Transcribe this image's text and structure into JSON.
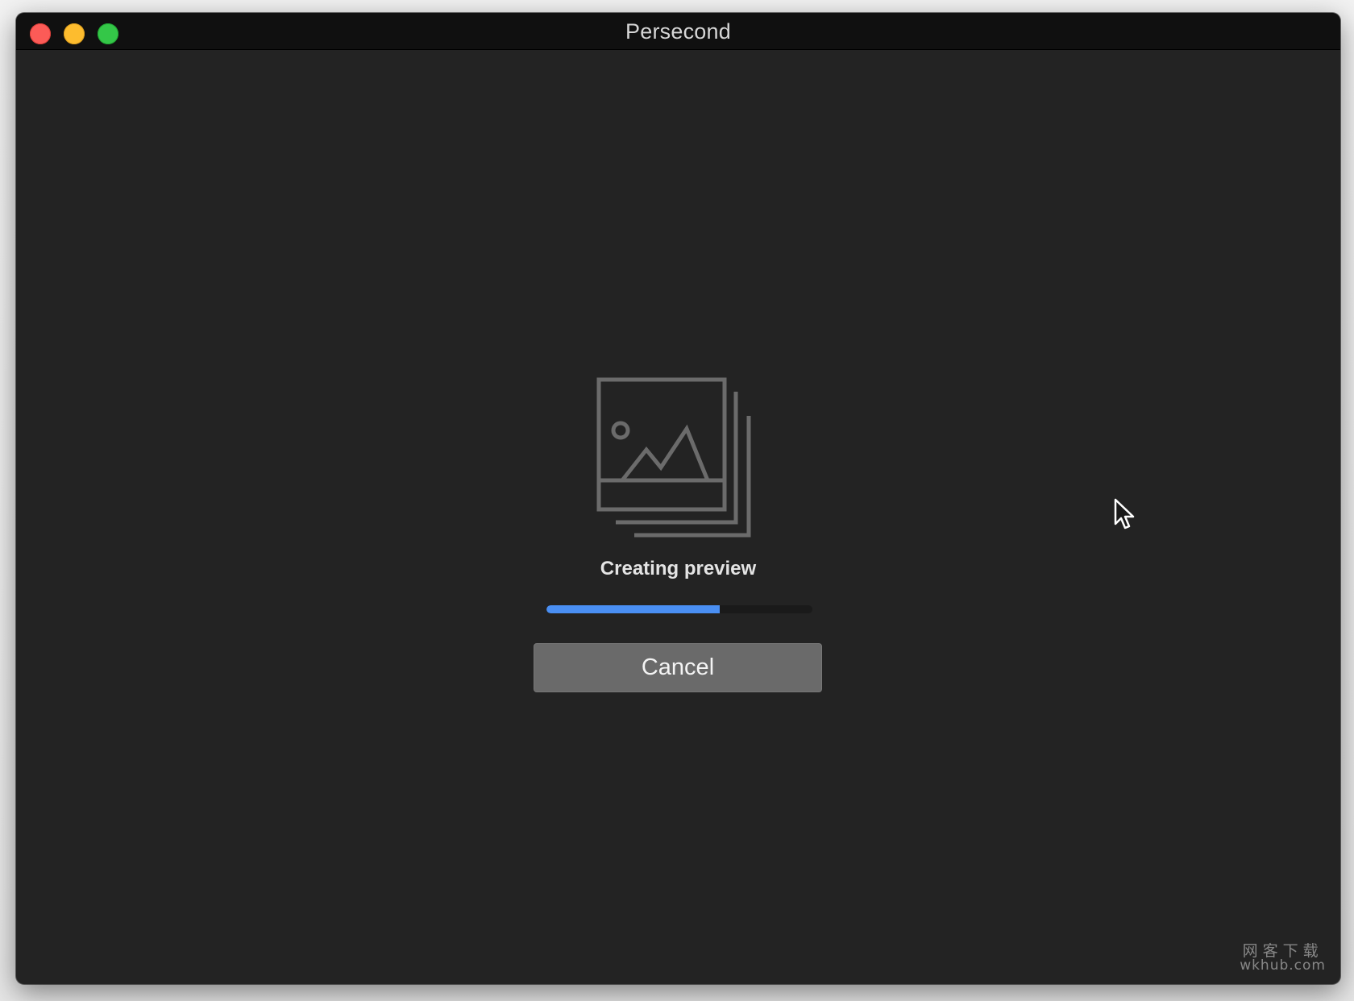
{
  "window": {
    "title": "Persecond"
  },
  "titlebar": {
    "buttons": [
      {
        "name": "close",
        "color": "#fc5b57"
      },
      {
        "name": "minimize",
        "color": "#fdbc2e"
      },
      {
        "name": "zoom",
        "color": "#34c748"
      }
    ]
  },
  "main": {
    "icon": "photo-stack-icon",
    "status_text": "Creating preview",
    "progress_fraction": 0.65,
    "progress_color": "#4a8ff3",
    "cancel_label": "Cancel"
  },
  "watermark": {
    "line1": "网客下载",
    "line2": "wkhub.com"
  }
}
